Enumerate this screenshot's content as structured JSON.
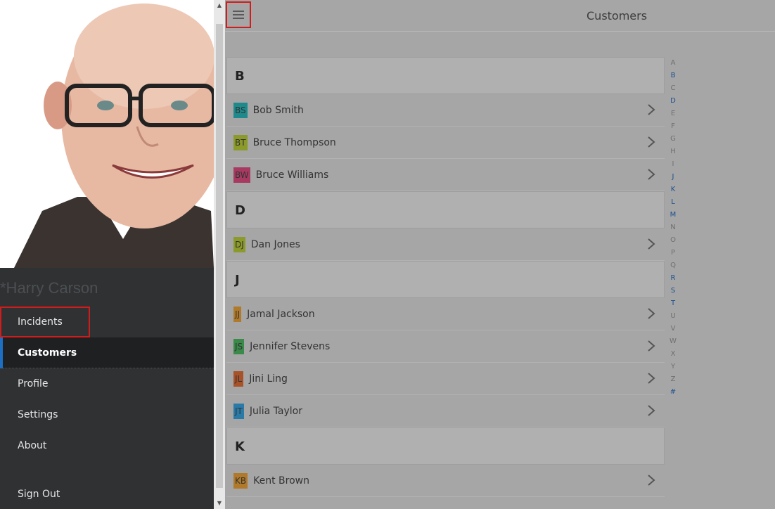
{
  "drawer": {
    "user_name": "*Harry Carson",
    "nav": [
      {
        "label": "Incidents",
        "state": "highlight"
      },
      {
        "label": "Customers",
        "state": "active"
      },
      {
        "label": "Profile",
        "state": ""
      },
      {
        "label": "Settings",
        "state": ""
      },
      {
        "label": "About",
        "state": ""
      }
    ],
    "sign_out": "Sign Out"
  },
  "header": {
    "title": "Customers",
    "menu_icon": "hamburger-icon"
  },
  "groups": [
    {
      "letter": "B",
      "items": [
        {
          "initials": "BS",
          "name": "Bob Smith",
          "color": "#1f8a8c"
        },
        {
          "initials": "BT",
          "name": "Bruce Thompson",
          "color": "#8c9a2a"
        },
        {
          "initials": "BW",
          "name": "Bruce Williams",
          "color": "#a83a62"
        }
      ]
    },
    {
      "letter": "D",
      "items": [
        {
          "initials": "DJ",
          "name": "Dan Jones",
          "color": "#8c9a2a"
        }
      ]
    },
    {
      "letter": "J",
      "items": [
        {
          "initials": "JJ",
          "name": "Jamal Jackson",
          "color": "#b07a2a"
        },
        {
          "initials": "JS",
          "name": "Jennifer Stevens",
          "color": "#3a8a4a"
        },
        {
          "initials": "JL",
          "name": "Jini Ling",
          "color": "#a8522a"
        },
        {
          "initials": "JT",
          "name": "Julia Taylor",
          "color": "#2a7aa8"
        }
      ]
    },
    {
      "letter": "K",
      "items": [
        {
          "initials": "KB",
          "name": "Kent Brown",
          "color": "#b07a2a"
        }
      ]
    }
  ],
  "index": [
    "A",
    "B",
    "C",
    "D",
    "E",
    "F",
    "G",
    "H",
    "I",
    "J",
    "K",
    "L",
    "M",
    "N",
    "O",
    "P",
    "Q",
    "R",
    "S",
    "T",
    "U",
    "V",
    "W",
    "X",
    "Y",
    "Z",
    "#"
  ],
  "index_active": [
    "B",
    "D",
    "J",
    "K",
    "L",
    "M",
    "R",
    "S",
    "T",
    "#"
  ],
  "colors": {
    "accent": "#1c6fc2",
    "highlight_outline": "#d01c1c",
    "drawer_bg": "#2f3133"
  }
}
